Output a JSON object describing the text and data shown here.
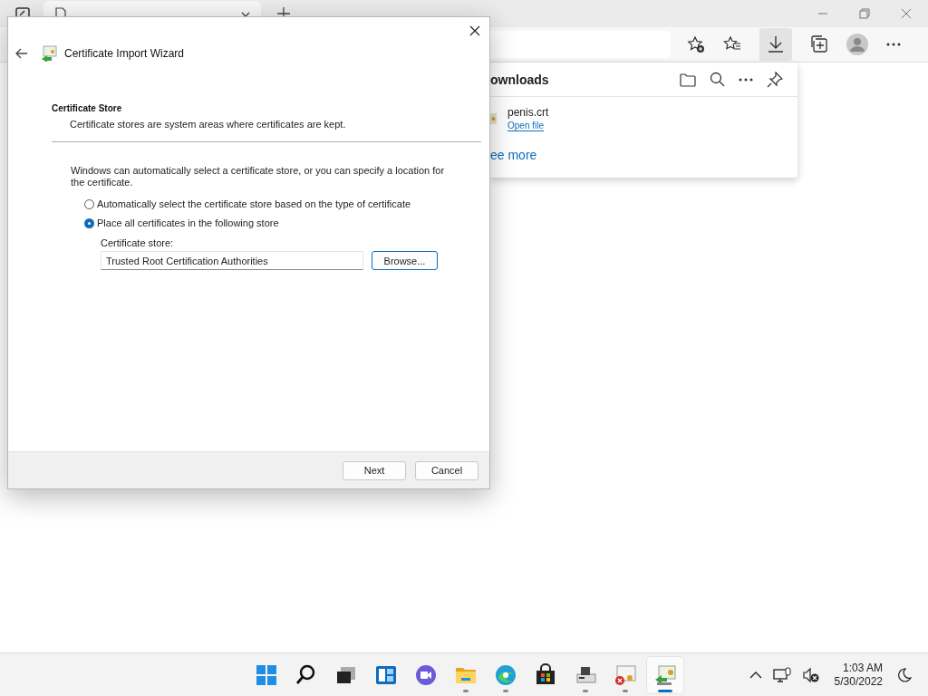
{
  "browser": {
    "downloads_panel": {
      "title": "ownloads",
      "items": [
        {
          "file": "penis.crt",
          "action": "Open file"
        }
      ],
      "see_more": "ee more"
    }
  },
  "dialog": {
    "title": "Certificate Import Wizard",
    "heading": "Certificate Store",
    "subheading": "Certificate stores are system areas where certificates are kept.",
    "description": "Windows can automatically select a certificate store, or you can specify a location for the certificate.",
    "options": [
      {
        "label": "Automatically select the certificate store based on the type of certificate",
        "selected": false
      },
      {
        "label": "Place all certificates in the following store",
        "selected": true
      }
    ],
    "store_label": "Certificate store:",
    "store_value": "Trusted Root Certification Authorities",
    "browse_button": "Browse...",
    "buttons": [
      {
        "label": "Next"
      },
      {
        "label": "Cancel"
      }
    ]
  },
  "taskbar": {
    "apps": [
      {
        "kind": "start",
        "running": false,
        "selected": false
      },
      {
        "kind": "search",
        "running": false,
        "selected": false
      },
      {
        "kind": "taskview",
        "running": false,
        "selected": false
      },
      {
        "kind": "widgets",
        "running": false,
        "selected": false
      },
      {
        "kind": "chat",
        "running": false,
        "selected": false
      },
      {
        "kind": "explorer",
        "running": true,
        "selected": false
      },
      {
        "kind": "edge",
        "running": true,
        "selected": false
      },
      {
        "kind": "store",
        "running": false,
        "selected": false
      },
      {
        "kind": "device",
        "running": true,
        "selected": false
      },
      {
        "kind": "certerror",
        "running": true,
        "selected": false
      },
      {
        "kind": "certimport",
        "running": true,
        "selected": true
      }
    ],
    "time": "1:03 AM",
    "date": "5/30/2022"
  }
}
